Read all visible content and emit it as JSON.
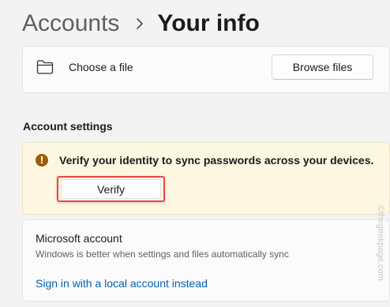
{
  "header": {
    "parent": "Accounts",
    "separator_icon": "chevron-right-icon",
    "current": "Your info"
  },
  "choose_file": {
    "icon": "folder-icon",
    "label": "Choose a file",
    "button_label": "Browse files"
  },
  "account_settings": {
    "heading": "Account settings",
    "warning": {
      "icon": "warning-icon",
      "icon_glyph": "!",
      "text": "Verify your identity to sync passwords across your devices.",
      "button_label": "Verify",
      "highlight_color": "#e5484d",
      "background_color": "#fdf7e1"
    },
    "microsoft_account": {
      "title": "Microsoft account",
      "description": "Windows is better when settings and files automatically sync",
      "link": "Sign in with a local account instead",
      "link_color": "#005fb8"
    }
  },
  "watermark": "©thegeekpage.com"
}
